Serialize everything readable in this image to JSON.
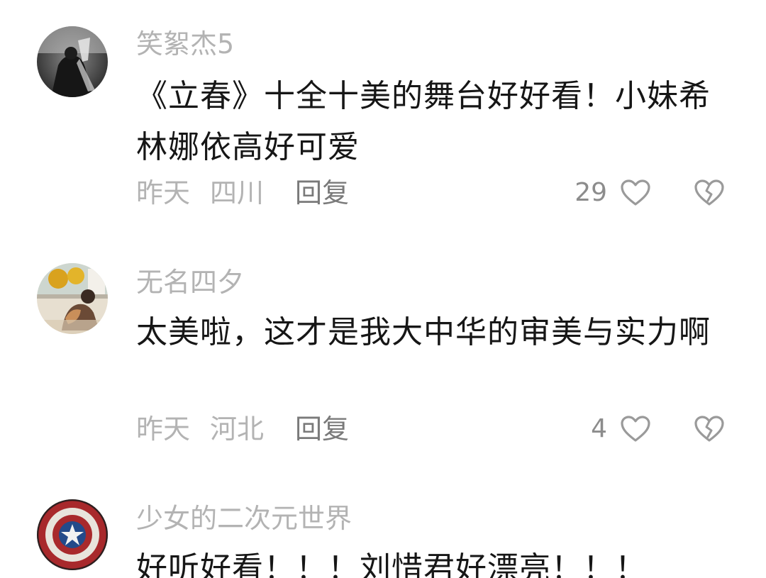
{
  "comments": [
    {
      "username": "笑絮杰5",
      "content": "《立春》十全十美的舞台好好看！小妹希林娜依高好可爱",
      "date": "昨天",
      "region": "四川",
      "reply_label": "回复",
      "likes": "29",
      "avatar_icon": "photo-avatar"
    },
    {
      "username": "无名四夕",
      "content": "太美啦，这才是我大中华的审美与实力啊",
      "date": "昨天",
      "region": "河北",
      "reply_label": "回复",
      "likes": "4",
      "avatar_icon": "photo-avatar"
    },
    {
      "username": "少女的二次元世界",
      "content": "好听好看！！！刘惜君好漂亮！！！",
      "avatar_icon": "shield-avatar"
    }
  ],
  "colors": {
    "username": "#b3b3b3",
    "content": "#161616",
    "meta": "#b3b3b3",
    "reply": "#7a7a7a",
    "icon": "#9a9a9a"
  },
  "icons": {
    "like": "heart-outline-icon",
    "dislike": "broken-heart-icon"
  }
}
